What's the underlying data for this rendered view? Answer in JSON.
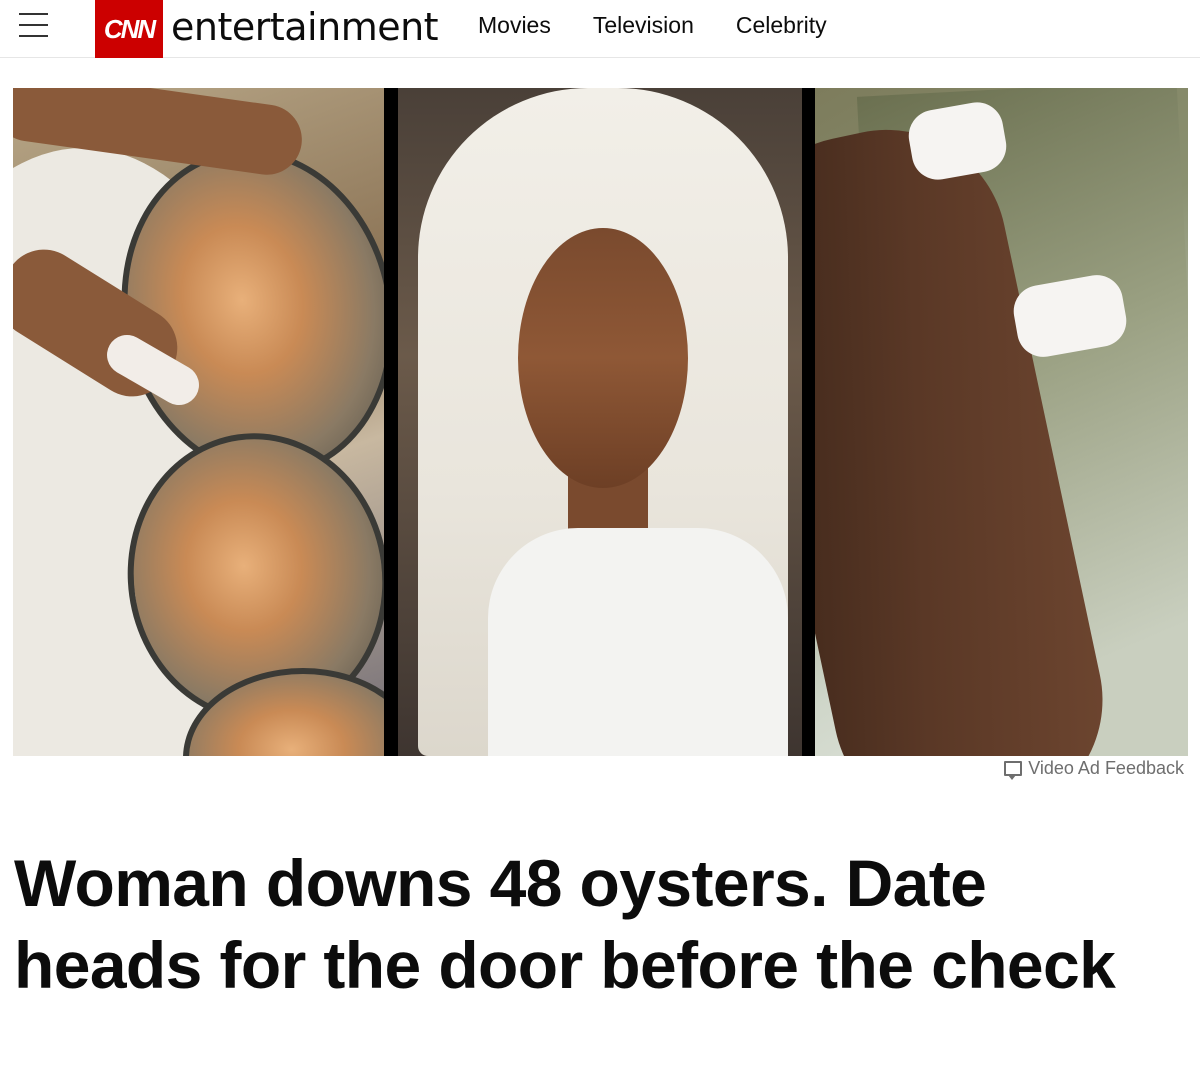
{
  "header": {
    "logo_text": "CNN",
    "section_name": "entertainment",
    "nav": [
      {
        "label": "Movies"
      },
      {
        "label": "Television"
      },
      {
        "label": "Celebrity"
      }
    ]
  },
  "media": {
    "feedback_label": "Video Ad Feedback"
  },
  "article": {
    "headline": "Woman downs 48 oysters. Date heads for the door before the check"
  },
  "colors": {
    "brand": "#cc0000",
    "text": "#0c0c0c",
    "muted": "#6e6e6e"
  }
}
